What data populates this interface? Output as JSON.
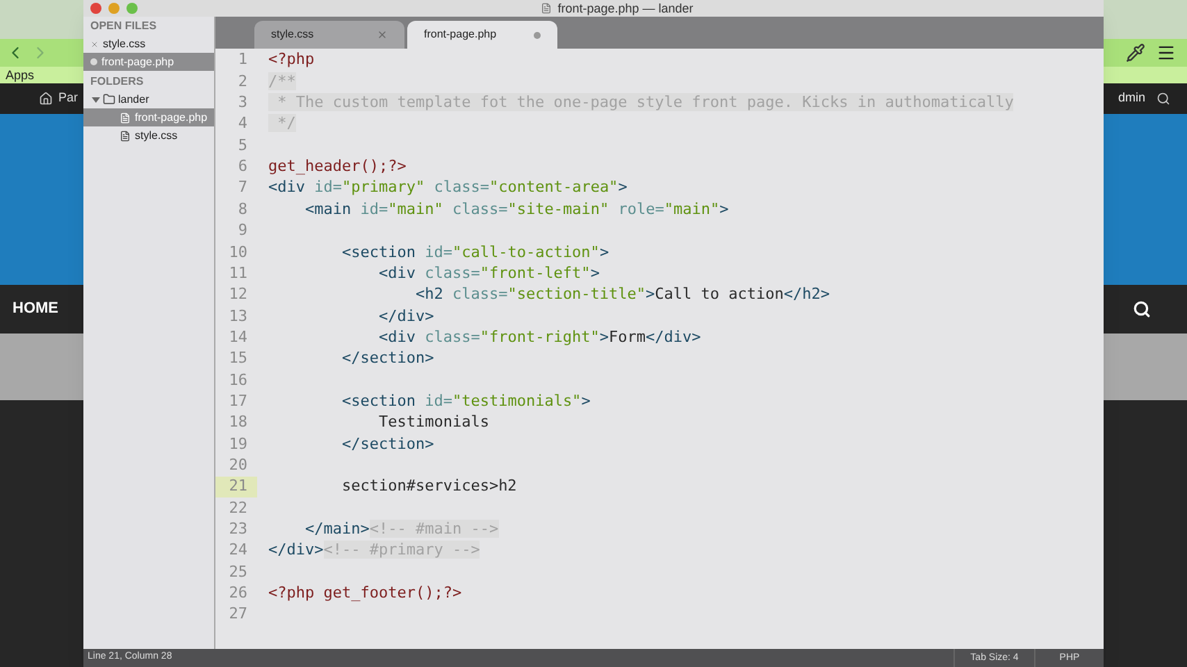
{
  "browser": {
    "bookmark": "Apps",
    "admin_bar": {
      "site": "Par",
      "user": "dmin"
    },
    "nav": [
      {
        "label": "HOME"
      }
    ]
  },
  "window": {
    "title": "front-page.php — lander"
  },
  "sidebar": {
    "open_files_label": "OPEN FILES",
    "open_files": [
      {
        "name": "style.css",
        "selected": false,
        "dirty": false
      },
      {
        "name": "front-page.php",
        "selected": true,
        "dirty": true
      }
    ],
    "folders_label": "FOLDERS",
    "folders": [
      {
        "name": "lander",
        "expanded": true,
        "children": [
          {
            "name": "front-page.php",
            "selected": true
          },
          {
            "name": "style.css",
            "selected": false
          }
        ]
      }
    ]
  },
  "tabs": [
    {
      "label": "style.css",
      "selected": false,
      "dirty": false
    },
    {
      "label": "front-page.php",
      "selected": true,
      "dirty": true
    }
  ],
  "lines": [
    {
      "number": "1",
      "current": false,
      "tokens": [
        {
          "kind": "php",
          "text": "<?php"
        }
      ]
    },
    {
      "number": "2",
      "current": false,
      "tokens": [
        {
          "kind": "comment",
          "text": "/**"
        }
      ]
    },
    {
      "number": "3",
      "current": false,
      "tokens": [
        {
          "kind": "comment",
          "text": " * The custom template fot the one-page style front page. Kicks in authomatically"
        }
      ]
    },
    {
      "number": "4",
      "current": false,
      "tokens": [
        {
          "kind": "comment",
          "text": " */"
        }
      ]
    },
    {
      "number": "5",
      "current": false
    },
    {
      "number": "6",
      "current": false,
      "tokens": [
        {
          "kind": "php",
          "text": "get_header();?>"
        }
      ]
    },
    {
      "number": "7",
      "current": false,
      "tokens": [
        {
          "kind": "tag",
          "text": "<div"
        },
        {
          "kind": "attr",
          "text": " id="
        },
        {
          "kind": "string",
          "text": "\"primary\""
        },
        {
          "kind": "attr",
          "text": " class="
        },
        {
          "kind": "string",
          "text": "\"content-area\""
        },
        {
          "kind": "tag",
          "text": ">"
        }
      ]
    },
    {
      "number": "8",
      "current": false,
      "tokens": [
        {
          "kind": "tag",
          "text": "    <main"
        },
        {
          "kind": "attr",
          "text": " id="
        },
        {
          "kind": "string",
          "text": "\"main\""
        },
        {
          "kind": "attr",
          "text": " class="
        },
        {
          "kind": "string",
          "text": "\"site-main\""
        },
        {
          "kind": "attr",
          "text": " role="
        },
        {
          "kind": "string",
          "text": "\"main\""
        },
        {
          "kind": "tag",
          "text": ">"
        }
      ]
    },
    {
      "number": "9",
      "current": false
    },
    {
      "number": "10",
      "current": false,
      "tokens": [
        {
          "kind": "tag",
          "text": "        <section"
        },
        {
          "kind": "attr",
          "text": " id="
        },
        {
          "kind": "string",
          "text": "\"call-to-action\""
        },
        {
          "kind": "tag",
          "text": ">"
        }
      ]
    },
    {
      "number": "11",
      "current": false,
      "tokens": [
        {
          "kind": "tag",
          "text": "            <div"
        },
        {
          "kind": "attr",
          "text": " class="
        },
        {
          "kind": "string",
          "text": "\"front-left\""
        },
        {
          "kind": "tag",
          "text": ">"
        }
      ]
    },
    {
      "number": "12",
      "current": false,
      "tokens": [
        {
          "kind": "tag",
          "text": "                <h2"
        },
        {
          "kind": "attr",
          "text": " class="
        },
        {
          "kind": "string",
          "text": "\"section-title\""
        },
        {
          "kind": "tag",
          "text": ">"
        },
        {
          "kind": "text",
          "text": "Call to action"
        },
        {
          "kind": "tag",
          "text": "</h2>"
        }
      ]
    },
    {
      "number": "13",
      "current": false,
      "tokens": [
        {
          "kind": "tag",
          "text": "            </div>"
        }
      ]
    },
    {
      "number": "14",
      "current": false,
      "tokens": [
        {
          "kind": "tag",
          "text": "            <div"
        },
        {
          "kind": "attr",
          "text": " class="
        },
        {
          "kind": "string",
          "text": "\"front-right\""
        },
        {
          "kind": "tag",
          "text": ">"
        },
        {
          "kind": "text",
          "text": "Form"
        },
        {
          "kind": "tag",
          "text": "</div>"
        }
      ]
    },
    {
      "number": "15",
      "current": false,
      "tokens": [
        {
          "kind": "tag",
          "text": "        </section>"
        }
      ]
    },
    {
      "number": "16",
      "current": false
    },
    {
      "number": "17",
      "current": false,
      "tokens": [
        {
          "kind": "tag",
          "text": "        <section"
        },
        {
          "kind": "attr",
          "text": " id="
        },
        {
          "kind": "string",
          "text": "\"testimonials\""
        },
        {
          "kind": "tag",
          "text": ">"
        }
      ]
    },
    {
      "number": "18",
      "current": false,
      "tokens": [
        {
          "kind": "text",
          "text": "            Testimonials"
        }
      ]
    },
    {
      "number": "19",
      "current": false,
      "tokens": [
        {
          "kind": "tag",
          "text": "        </section>"
        }
      ]
    },
    {
      "number": "20",
      "current": false
    },
    {
      "number": "21",
      "current": true,
      "tokens": [
        {
          "kind": "text",
          "text": "        section#services>h2"
        }
      ]
    },
    {
      "number": "22",
      "current": false
    },
    {
      "number": "23",
      "current": false,
      "tokens": [
        {
          "kind": "tag",
          "text": "    </main>"
        },
        {
          "kind": "comment",
          "text": "<!-- #main -->"
        }
      ]
    },
    {
      "number": "24",
      "current": false,
      "tokens": [
        {
          "kind": "tag",
          "text": "</div>"
        },
        {
          "kind": "comment",
          "text": "<!-- #primary -->"
        }
      ]
    },
    {
      "number": "25",
      "current": false
    },
    {
      "number": "26",
      "current": false,
      "tokens": [
        {
          "kind": "php",
          "text": "<?php get_footer();?>"
        }
      ]
    },
    {
      "number": "27",
      "current": false
    }
  ],
  "status_bar": {
    "position": "Line 21, Column 28",
    "tab_size": "Tab Size: 4",
    "syntax": "PHP"
  }
}
